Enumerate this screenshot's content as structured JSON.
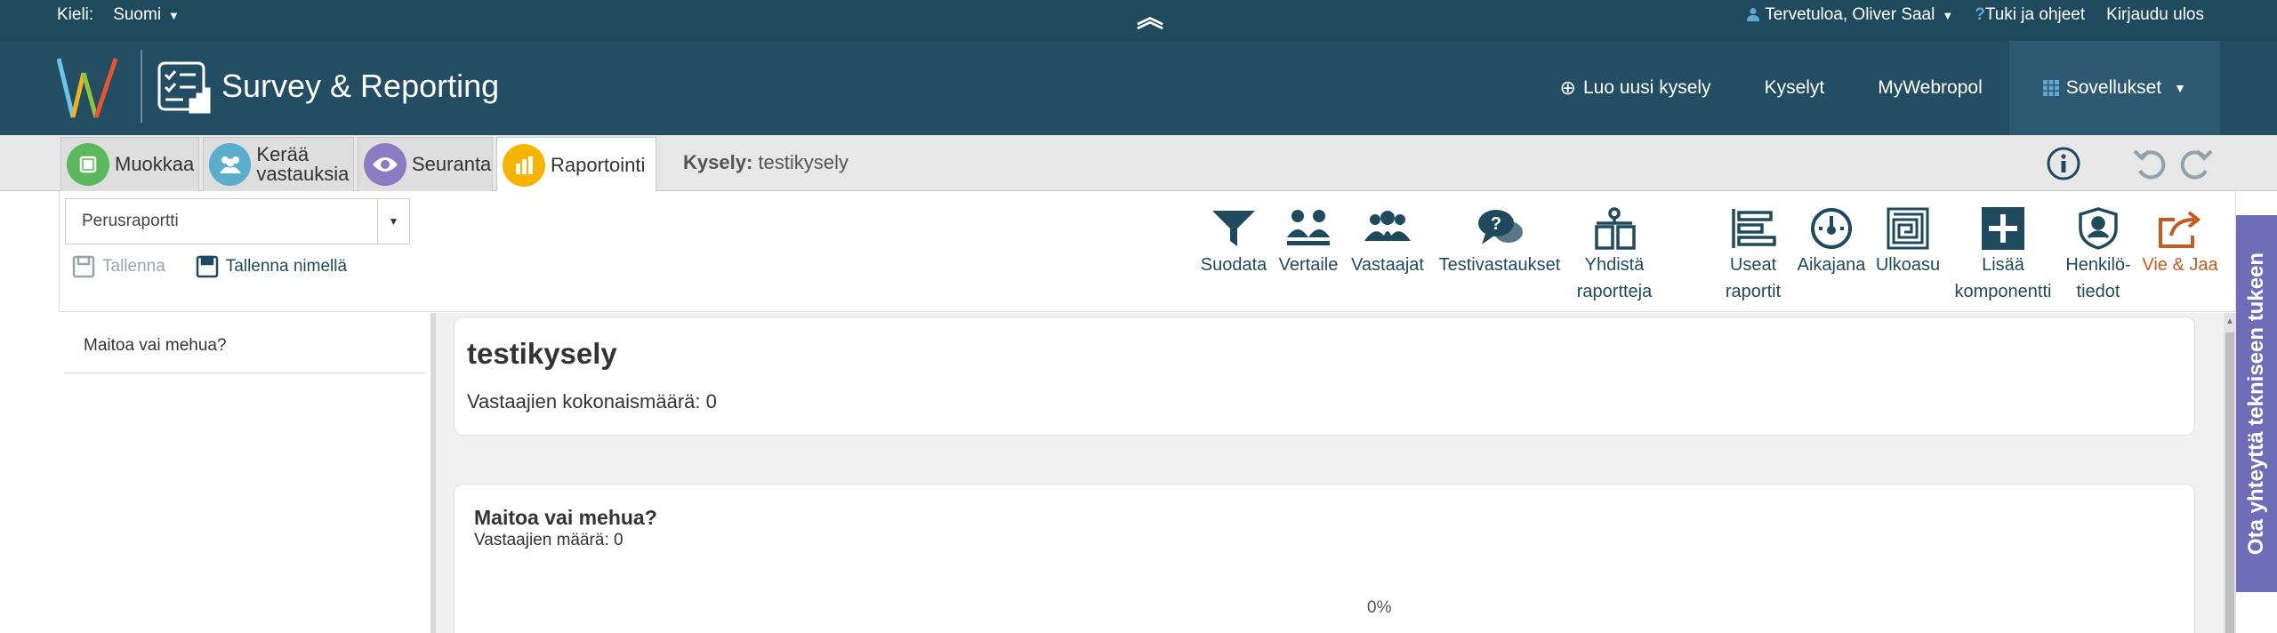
{
  "topbar": {
    "language_label": "Kieli:",
    "language_value": "Suomi",
    "user_greeting": "Tervetuloa, Oliver Saal",
    "help": "Tuki ja ohjeet",
    "logout": "Kirjaudu ulos"
  },
  "header": {
    "app_title": "Survey & Reporting",
    "nav": {
      "create_survey": "Luo uusi kysely",
      "surveys": "Kyselyt",
      "mywebropol": "MyWebropol",
      "applications": "Sovellukset"
    }
  },
  "tabs": [
    {
      "label": "Muokkaa",
      "color": "#5cb85c"
    },
    {
      "label": "Kerää vastauksia",
      "color": "#5aaecb"
    },
    {
      "label": "Seuranta",
      "color": "#8a7bc2"
    },
    {
      "label": "Raportointi",
      "color": "#f4b400"
    }
  ],
  "survey": {
    "label": "Kysely:",
    "name": "testikysely"
  },
  "toolbar": {
    "report_select_value": "Perusraportti",
    "save": "Tallenna",
    "save_as": "Tallenna nimellä",
    "tools": [
      {
        "line1": "Suodata",
        "line2": "",
        "icon": "filter-icon"
      },
      {
        "line1": "Vertaile",
        "line2": "",
        "icon": "compare-icon"
      },
      {
        "line1": "Vastaajat",
        "line2": "",
        "icon": "respondents-icon"
      },
      {
        "line1": "Testivastaukset",
        "line2": "",
        "icon": "test-answers-icon"
      },
      {
        "line1": "Yhdistä",
        "line2": "raportteja",
        "icon": "merge-reports-icon"
      },
      {
        "line1": "Useat",
        "line2": "raportit",
        "icon": "multiple-reports-icon"
      },
      {
        "line1": "Aikajana",
        "line2": "",
        "icon": "timeline-icon"
      },
      {
        "line1": "Ulkoasu",
        "line2": "",
        "icon": "layout-icon"
      },
      {
        "line1": "Lisää",
        "line2": "komponentti",
        "icon": "add-component-icon"
      },
      {
        "line1": "Henkilö-",
        "line2": "tiedot",
        "icon": "personal-data-icon"
      },
      {
        "line1": "Vie & Jaa",
        "line2": "",
        "icon": "export-share-icon"
      }
    ]
  },
  "sidebar": {
    "questions": [
      "Maitoa vai mehua?"
    ]
  },
  "report": {
    "title": "testikysely",
    "total_respondents": "Vastaajien kokonaismäärä: 0",
    "question": {
      "title": "Maitoa vai mehua?",
      "respondents": "Vastaajien määrä: 0",
      "percent": "0%"
    }
  },
  "contact_tab": "Ota yhteyttä tekniseen tukeen"
}
